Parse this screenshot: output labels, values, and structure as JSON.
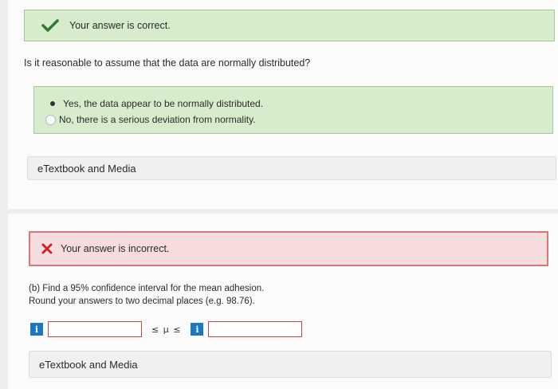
{
  "part_a": {
    "status_text": "Your answer is correct.",
    "question": "Is it reasonable to assume that the data are normally distributed?",
    "options": [
      "Yes, the data appear to be normally distributed.",
      "No, there is a serious deviation from normality."
    ],
    "selected_option_index": 0,
    "media_label": "eTextbook and Media"
  },
  "part_b": {
    "status_text": "Your answer is incorrect.",
    "question_line1": "(b) Find a 95% confidence interval for the mean adhesion.",
    "question_line2": "Round your answers to two decimal places (e.g. 98.76).",
    "info_label": "i",
    "inequality": "≤ μ ≤",
    "lower_value": "",
    "upper_value": "",
    "media_label": "eTextbook and Media"
  },
  "colors": {
    "correct_bg": "#d6eccc",
    "correct_check": "#2e7d32",
    "incorrect_bg": "#f6dddd",
    "incorrect_border": "#d4797b",
    "incorrect_x": "#c62828",
    "info_blue": "#1a78c2"
  },
  "icons": [
    "check-icon",
    "x-icon",
    "info-icon"
  ]
}
